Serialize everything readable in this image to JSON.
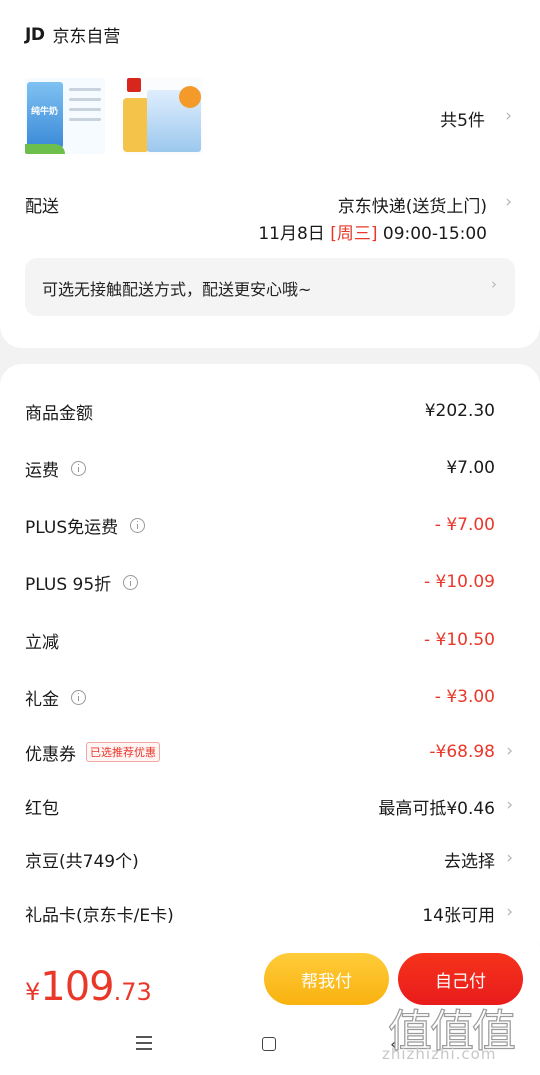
{
  "store": {
    "logo": "JD",
    "name": "京东自营"
  },
  "products": {
    "count_label": "共5件",
    "items": [
      {
        "icon": "milk-carton-product"
      },
      {
        "icon": "milk-powder-product"
      }
    ]
  },
  "shipping": {
    "label": "配送",
    "method": "京东快递(送货上门)",
    "date": "11月8日",
    "weekday": "[周三]",
    "time": "09:00-15:00"
  },
  "notice": {
    "text": "可选无接触配送方式，配送更安心哦~"
  },
  "fees": [
    {
      "label": "商品金额",
      "value": "¥202.30",
      "info": false,
      "red": false,
      "chevron": false
    },
    {
      "label": "运费",
      "value": "¥7.00",
      "info": true,
      "red": false,
      "chevron": false
    },
    {
      "label": "PLUS免运费",
      "value": "- ¥7.00",
      "info": true,
      "red": true,
      "chevron": false
    },
    {
      "label": "PLUS 95折",
      "value": "- ¥10.09",
      "info": true,
      "red": true,
      "chevron": false
    },
    {
      "label": "立减",
      "value": "- ¥10.50",
      "info": false,
      "red": true,
      "chevron": false
    },
    {
      "label": "礼金",
      "value": "- ¥3.00",
      "info": true,
      "red": true,
      "chevron": false
    },
    {
      "label": "优惠券",
      "value": "-¥68.98",
      "tag": "已选推荐优惠",
      "info": false,
      "red": true,
      "chevron": true
    },
    {
      "label": "红包",
      "value": "最高可抵¥0.46",
      "info": false,
      "red": false,
      "chevron": true
    },
    {
      "label": "京豆(共749个)",
      "value": "去选择",
      "info": false,
      "red": false,
      "chevron": true
    },
    {
      "label": "礼品卡(京东卡/E卡)",
      "value": "14张可用",
      "info": false,
      "red": false,
      "chevron": true
    }
  ],
  "total": {
    "currency": "¥",
    "integer": "109",
    "decimal": ".73"
  },
  "buttons": {
    "friend_pay": "帮我付",
    "self_pay": "自己付"
  },
  "watermark": {
    "glyphs": "值值值",
    "url": "zhizhizhi.com"
  },
  "colors": {
    "accent_red": "#e9382a",
    "button_yellow": "#f9b20f",
    "button_red": "#e81c1c"
  }
}
